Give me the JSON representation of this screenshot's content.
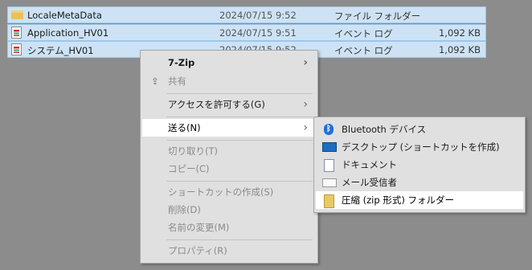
{
  "files": [
    {
      "name": "LocaleMetaData",
      "date": "2024/07/15 9:52",
      "type": "ファイル フォルダー",
      "size": "",
      "icon": "folder-icon"
    },
    {
      "name": "Application_HV01",
      "date": "2024/07/15 9:51",
      "type": "イベント ログ",
      "size": "1,092 KB",
      "icon": "event-log-icon"
    },
    {
      "name": "システム_HV01",
      "date": "2024/07/15 9:52",
      "type": "イベント ログ",
      "size": "1,092 KB",
      "icon": "event-log-icon"
    }
  ],
  "context_menu": {
    "seven_zip": "7-Zip",
    "share": "共有",
    "grant_access": "アクセスを許可する(G)",
    "send_to": "送る(N)",
    "cut": "切り取り(T)",
    "copy": "コピー(C)",
    "create_shortcut": "ショートカットの作成(S)",
    "delete": "削除(D)",
    "rename": "名前の変更(M)",
    "properties": "プロパティ(R)",
    "highlighted": "送る(N)"
  },
  "send_to_menu": {
    "bluetooth": "Bluetooth デバイス",
    "desktop": "デスクトップ (ショートカットを作成)",
    "documents": "ドキュメント",
    "mail": "メール受信者",
    "zip": "圧縮 (zip 形式) フォルダー",
    "highlighted": "圧縮 (zip 形式) フォルダー"
  },
  "colors": {
    "selection": "#cde3f5",
    "menu_bg": "#e0e0e0",
    "highlight": "#ffffff",
    "desktop_bg": "#8c8c8c"
  }
}
